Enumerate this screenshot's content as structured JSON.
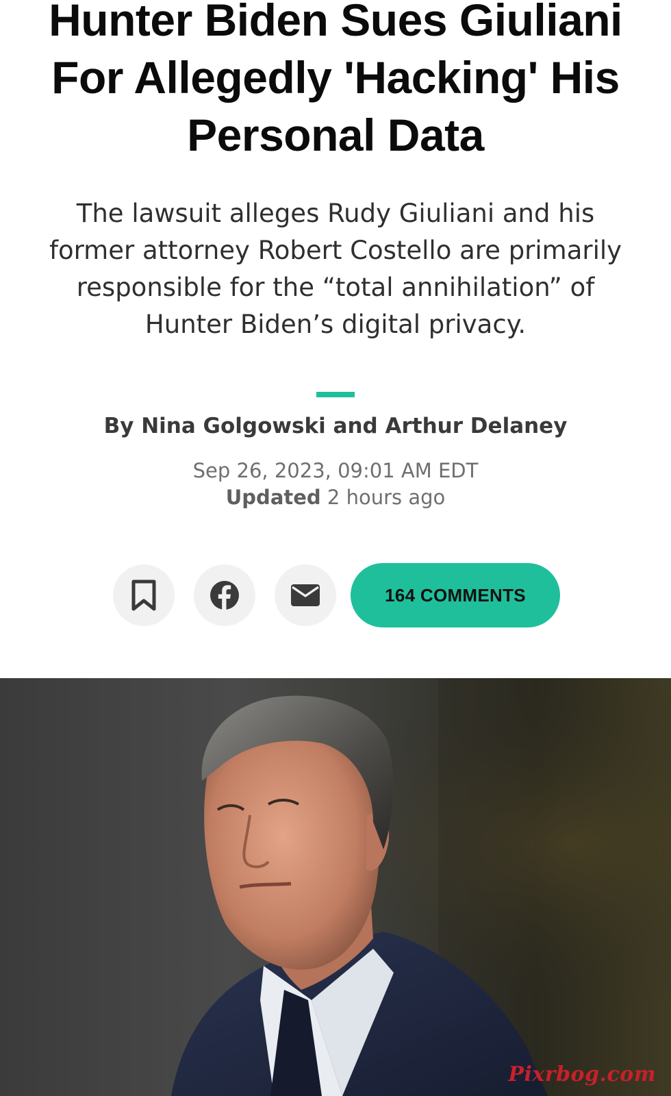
{
  "article": {
    "headline": "Hunter Biden Sues Giuliani For Allegedly 'Hacking' His Personal Data",
    "dek": "The lawsuit alleges Rudy Giuliani and his former attorney Robert Costello are primarily responsible for the “total annihilation” of Hunter Biden’s digital privacy.",
    "byline": "By Nina Golgowski and Arthur Delaney",
    "published": "Sep 26, 2023, 09:01 AM EDT",
    "updated_label": "Updated",
    "updated_value": "2 hours ago"
  },
  "share": {
    "bookmark_icon": "bookmark-icon",
    "facebook_icon": "facebook-icon",
    "email_icon": "email-icon",
    "comments_label": "164 COMMENTS"
  },
  "photo": {
    "watermark": "Pixrbog.com"
  },
  "colors": {
    "accent": "#1fbf9c",
    "headline": "#0b0b0b",
    "body_text": "#2f2f2f",
    "meta_text": "#6f6f6f",
    "button_bg": "#f1f1f1",
    "watermark": "#c8202a"
  }
}
